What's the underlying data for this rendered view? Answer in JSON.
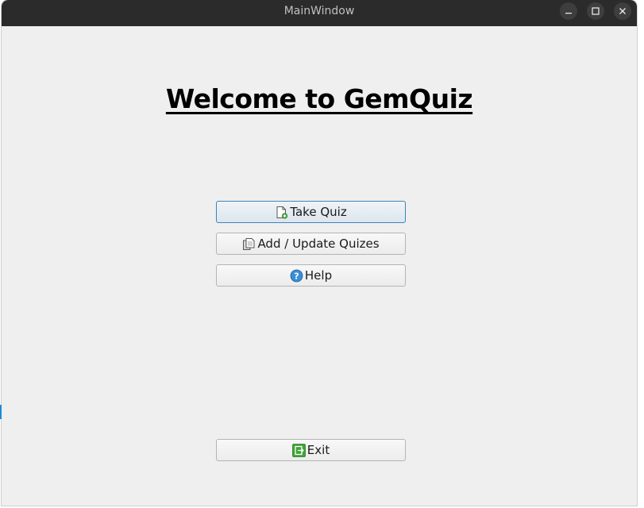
{
  "window": {
    "title": "MainWindow",
    "controls": [
      "minimize-icon",
      "maximize-icon",
      "close-icon"
    ]
  },
  "main": {
    "heading": "Welcome to GemQuiz",
    "buttons": {
      "take_quiz": {
        "label": "Take Quiz",
        "icon": "new-document-icon"
      },
      "add_update": {
        "label": "Add / Update Quizes",
        "icon": "copy-documents-icon"
      },
      "help": {
        "label": "Help",
        "icon": "help-icon"
      },
      "exit": {
        "label": "Exit",
        "icon": "exit-icon"
      }
    }
  },
  "colors": {
    "titlebar": "#2b2b2b",
    "window_bg": "#efefef",
    "focus_border": "#3d84b8",
    "help_icon": "#3a8fd6",
    "exit_icon": "#3fa535"
  }
}
